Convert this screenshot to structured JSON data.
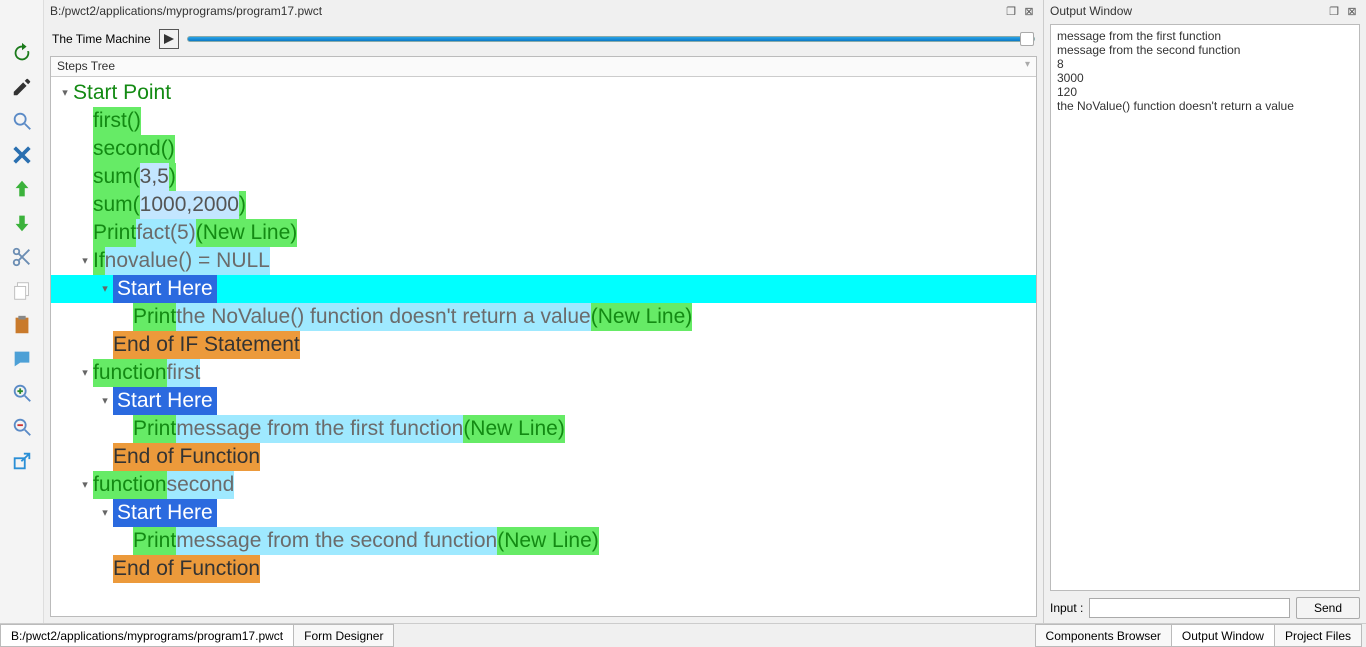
{
  "editor": {
    "title_path": "B:/pwct2/applications/myprograms/program17.pwct",
    "time_machine_label": "The Time Machine",
    "steps_tree_label": "Steps Tree"
  },
  "toolbar": {
    "items": [
      "refresh-icon",
      "edit-icon",
      "search-icon",
      "delete-x-icon",
      "arrow-up-icon",
      "arrow-down-icon",
      "cut-icon",
      "copy-icon",
      "paste-icon",
      "comment-icon",
      "zoom-in-icon",
      "zoom-out-icon",
      "popout-icon"
    ]
  },
  "tree": {
    "rows": [
      {
        "indent": 0,
        "toggle": "-",
        "segs": [
          {
            "t": "Start Point",
            "cls": "kw-green"
          }
        ]
      },
      {
        "indent": 1,
        "toggle": "",
        "segs": [
          {
            "t": "first()",
            "cls": "kw-green hl-green"
          }
        ]
      },
      {
        "indent": 1,
        "toggle": "",
        "segs": [
          {
            "t": "second()",
            "cls": "kw-green hl-green"
          }
        ]
      },
      {
        "indent": 1,
        "toggle": "",
        "segs": [
          {
            "t": "sum(",
            "cls": "kw-green hl-green"
          },
          {
            "t": "3,5",
            "cls": "hl-param"
          },
          {
            "t": ")",
            "cls": "kw-green hl-green"
          }
        ]
      },
      {
        "indent": 1,
        "toggle": "",
        "segs": [
          {
            "t": "sum(",
            "cls": "kw-green hl-green"
          },
          {
            "t": "1000,2000",
            "cls": "hl-param"
          },
          {
            "t": ")",
            "cls": "kw-green hl-green"
          }
        ]
      },
      {
        "indent": 1,
        "toggle": "",
        "segs": [
          {
            "t": "Print ",
            "cls": "kw-green hl-green"
          },
          {
            "t": "fact(5)",
            "cls": "hl-cyan txt-gray"
          },
          {
            "t": " (New Line)",
            "cls": "kw-green hl-green"
          }
        ]
      },
      {
        "indent": 1,
        "toggle": "-",
        "segs": [
          {
            "t": "If ",
            "cls": "kw-green hl-green"
          },
          {
            "t": "novalue() = NULL",
            "cls": "hl-cyan txt-gray"
          }
        ]
      },
      {
        "indent": 2,
        "toggle": "-",
        "selected": true,
        "segs": [
          {
            "t": "Start Here",
            "cls": "start-here"
          }
        ]
      },
      {
        "indent": 3,
        "toggle": "",
        "segs": [
          {
            "t": "Print ",
            "cls": "kw-green hl-green"
          },
          {
            "t": "the NoValue() function doesn't return a value",
            "cls": "hl-cyan txt-gray"
          },
          {
            "t": " (New Line)",
            "cls": "kw-green hl-green"
          }
        ]
      },
      {
        "indent": 2,
        "toggle": "",
        "segs": [
          {
            "t": "End of IF Statement",
            "cls": "hl-orange txt-dark"
          }
        ]
      },
      {
        "indent": 1,
        "toggle": "-",
        "segs": [
          {
            "t": "function ",
            "cls": "kw-green hl-green"
          },
          {
            "t": "first",
            "cls": "hl-cyan txt-gray"
          }
        ]
      },
      {
        "indent": 2,
        "toggle": "-",
        "segs": [
          {
            "t": "Start Here",
            "cls": "start-here"
          }
        ]
      },
      {
        "indent": 3,
        "toggle": "",
        "segs": [
          {
            "t": "Print ",
            "cls": "kw-green hl-green"
          },
          {
            "t": "message from the first function",
            "cls": "hl-cyan txt-gray"
          },
          {
            "t": " (New Line)",
            "cls": "kw-green hl-green"
          }
        ]
      },
      {
        "indent": 2,
        "toggle": "",
        "segs": [
          {
            "t": "End of Function",
            "cls": "hl-orange txt-dark"
          }
        ]
      },
      {
        "indent": 1,
        "toggle": "-",
        "segs": [
          {
            "t": "function ",
            "cls": "kw-green hl-green"
          },
          {
            "t": "second",
            "cls": "hl-cyan txt-gray"
          }
        ]
      },
      {
        "indent": 2,
        "toggle": "-",
        "segs": [
          {
            "t": "Start Here",
            "cls": "start-here"
          }
        ]
      },
      {
        "indent": 3,
        "toggle": "",
        "segs": [
          {
            "t": "Print ",
            "cls": "kw-green hl-green"
          },
          {
            "t": "message from the second function",
            "cls": "hl-cyan txt-gray"
          },
          {
            "t": " (New Line)",
            "cls": "kw-green hl-green"
          }
        ]
      },
      {
        "indent": 2,
        "toggle": "",
        "segs": [
          {
            "t": "End of Function",
            "cls": "hl-orange txt-dark"
          }
        ]
      }
    ]
  },
  "output": {
    "title": "Output Window",
    "lines": [
      "message from the first function",
      "message from the second function",
      "8",
      "3000",
      "120",
      "the NoValue() function doesn't return a value"
    ],
    "input_label": "Input :",
    "send_label": "Send"
  },
  "bottom": {
    "left_tabs": [
      "B:/pwct2/applications/myprograms/program17.pwct",
      "Form Designer"
    ],
    "right_tabs": [
      "Components Browser",
      "Output Window",
      "Project Files"
    ],
    "active_right": 1
  }
}
